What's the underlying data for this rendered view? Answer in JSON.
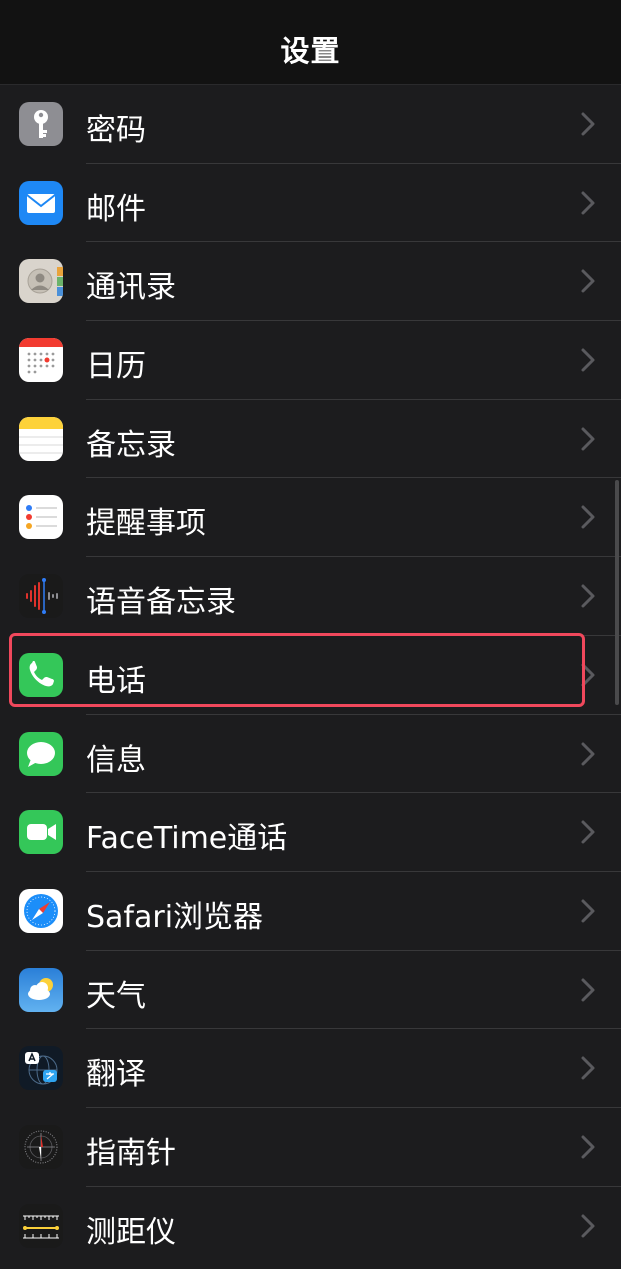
{
  "navbar": {
    "title": "设置"
  },
  "items": [
    {
      "label": "密码",
      "icon": "key-icon"
    },
    {
      "label": "邮件",
      "icon": "mail-icon"
    },
    {
      "label": "通讯录",
      "icon": "contacts-icon"
    },
    {
      "label": "日历",
      "icon": "calendar-icon"
    },
    {
      "label": "备忘录",
      "icon": "notes-icon"
    },
    {
      "label": "提醒事项",
      "icon": "reminders-icon"
    },
    {
      "label": "语音备忘录",
      "icon": "voice-memos-icon"
    },
    {
      "label": "电话",
      "icon": "phone-icon",
      "highlighted": true
    },
    {
      "label": "信息",
      "icon": "messages-icon"
    },
    {
      "label": "FaceTime通话",
      "icon": "facetime-icon"
    },
    {
      "label": "Safari浏览器",
      "icon": "safari-icon"
    },
    {
      "label": "天气",
      "icon": "weather-icon"
    },
    {
      "label": "翻译",
      "icon": "translate-icon"
    },
    {
      "label": "指南针",
      "icon": "compass-icon"
    },
    {
      "label": "测距仪",
      "icon": "measure-icon"
    }
  ],
  "colors": {
    "background": "#1c1c1e",
    "navbar": "#121212",
    "separator": "#38383a",
    "highlight": "#f0485c",
    "chevron": "#5a5a5e"
  }
}
